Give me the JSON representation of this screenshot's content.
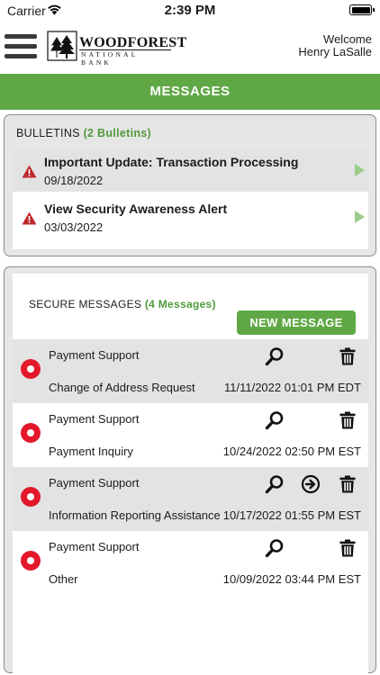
{
  "status_bar": {
    "carrier": "Carrier",
    "time": "2:39 PM"
  },
  "header": {
    "logo_name": "WOODFOREST",
    "logo_sub": "NATIONAL BANK",
    "welcome_line1": "Welcome",
    "welcome_line2": "Henry LaSalle"
  },
  "banner": {
    "title": "MESSAGES"
  },
  "bulletins": {
    "title": "BULLETINS",
    "count": "(2 Bulletins)",
    "items": [
      {
        "headline": "Important Update: Transaction Processing",
        "date": "09/18/2022"
      },
      {
        "headline": "View Security Awareness Alert",
        "date": "03/03/2022"
      }
    ]
  },
  "secure_messages": {
    "title": "SECURE MESSAGES",
    "count": "(4 Messages)",
    "new_button": "NEW MESSAGE",
    "items": [
      {
        "from": "Payment Support",
        "subject": "Change of Address Request",
        "date": "11/11/2022 01:01 PM EDT"
      },
      {
        "from": "Payment Support",
        "subject": "Payment Inquiry",
        "date": "10/24/2022 02:50 PM EST"
      },
      {
        "from": "Payment Support",
        "subject": "Information Reporting Assistance",
        "date": "10/17/2022 01:55 PM EST"
      },
      {
        "from": "Payment Support",
        "subject": "Other",
        "date": "10/09/2022 03:44 PM EST"
      }
    ]
  },
  "colors": {
    "brand_green": "#60a846",
    "unread_red": "#e3182b",
    "alert_red": "#c0282d"
  },
  "icons": [
    "wifi-icon",
    "battery-icon",
    "menu-icon",
    "tree-logo-icon",
    "warning-icon",
    "chevron-right-icon",
    "unread-dot-icon",
    "search-icon",
    "forward-icon",
    "trash-icon"
  ]
}
